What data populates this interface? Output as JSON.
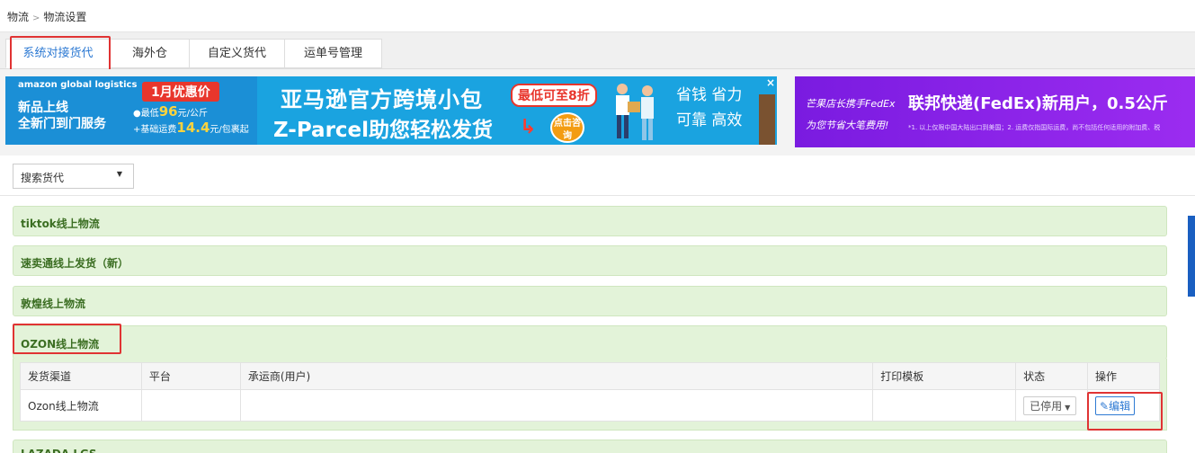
{
  "breadcrumb": {
    "root": "物流",
    "separator": ">",
    "current": "物流设置"
  },
  "tabs": [
    {
      "label": "系统对接货代",
      "active": true
    },
    {
      "label": "海外仓",
      "active": false
    },
    {
      "label": "自定义货代",
      "active": false
    },
    {
      "label": "运单号管理",
      "active": false
    }
  ],
  "banner1": {
    "brand": "amazon global logistics",
    "line1": "新品上线",
    "line2": "全新门到门服务",
    "promo_tag": "1月优惠价",
    "price_line1_prefix": "●最低",
    "price_line1_value": "96",
    "price_line1_suffix": "元/公斤",
    "price_line2_prefix": "+基础运费",
    "price_line2_value": "14.4",
    "price_line2_suffix": "元/包裹起",
    "headline": "亚马逊官方跨境小包",
    "discount": "最低可至8折",
    "subheadline": "Z-Parcel助您轻松发货",
    "cta": "点击咨询",
    "slogan1": "省钱 省力",
    "slogan2": "可靠 高效",
    "close": "×"
  },
  "banner2": {
    "small": "芒果店长携手FedEx",
    "headline": "联邦快递(FedEx)新用户，0.5公斤",
    "sub": "为您节省大笔费用!",
    "note": "*1. 以上仅限中国大陆出口到美国；2. 运费仅指国际运费，尚不包括任何适用的附加费、税"
  },
  "search": {
    "label": "搜索货代",
    "caret": "▼"
  },
  "groups": [
    {
      "label": "tiktok线上物流"
    },
    {
      "label": "速卖通线上发货（新）"
    },
    {
      "label": "敦煌线上物流"
    },
    {
      "label": "OZON线上物流"
    },
    {
      "label": "LAZADA LGS"
    }
  ],
  "table": {
    "headers": [
      "发货渠道",
      "平台",
      "承运商(用户)",
      "打印模板",
      "状态",
      "操作"
    ],
    "rows": [
      {
        "channel": "Ozon线上物流",
        "platform": "",
        "carrier": "",
        "template": "",
        "status": "已停用",
        "action": "编辑"
      }
    ]
  },
  "colors": {
    "accent": "#2e7ad3",
    "highlight_box": "#e03333",
    "group_bg": "#e3f3d9",
    "group_text": "#3b6e22"
  }
}
